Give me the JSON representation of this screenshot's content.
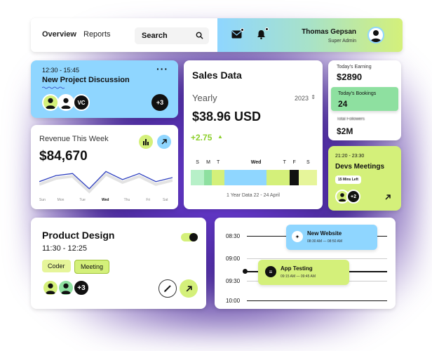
{
  "topbar": {
    "nav": [
      "Overview",
      "Reports"
    ],
    "search_placeholder": "Search",
    "user_name": "Thomas Gepsan",
    "user_role": "Super Admin"
  },
  "meeting_card": {
    "time": "12:30 - 15:45",
    "title": "New Project Discussion",
    "avatar_initials": "VC",
    "extra_count": "+3"
  },
  "revenue": {
    "title": "Revenue This Week",
    "amount": "$84,670",
    "days": [
      "Sun",
      "Mon",
      "Tue",
      "Wed",
      "Thu",
      "Fri",
      "Sat"
    ],
    "active_day": "Wed",
    "series": [
      52,
      58,
      60,
      45,
      62,
      54,
      60,
      52,
      56
    ]
  },
  "sales": {
    "title": "Sales Data",
    "period": "Yearly",
    "year": "2023",
    "amount": "$38.96 USD",
    "change": "+2.75",
    "day_labels": [
      "S",
      "M",
      "T",
      "",
      "Wed",
      "",
      "T",
      "F",
      "S"
    ],
    "footer": "1 Year Data 22 - 24 April",
    "bar_colors": [
      "#b7f0c8",
      "#8ee0a0",
      "#d4f07a",
      "#8fd6ff",
      "#8fd6ff",
      "#d4f07a",
      "#d4f07a",
      "#111111",
      "#e6f59a"
    ]
  },
  "earnings": {
    "today_label": "Today's Earning",
    "today_amount": "$2890",
    "bookings_label": "Today's Bookings",
    "bookings_count": "24",
    "bottom_amount": "$2M",
    "blurred_text": "Total Followers"
  },
  "devs": {
    "time": "21:20 - 23:30",
    "title": "Devs Meetings",
    "badge": "15 Mins Left",
    "extra_count": "+2"
  },
  "product": {
    "title": "Product Design",
    "time": "11:30 - 12:25",
    "tags": [
      "Coder",
      "Meeting"
    ],
    "extra_count": "+3"
  },
  "schedule": {
    "times": [
      "08:30",
      "09:00",
      "09:30",
      "10:00"
    ],
    "events": [
      {
        "title": "New Website",
        "time": "08:30 AM — 08:50 AM"
      },
      {
        "title": "App Testing",
        "time": "09:15 AM — 09:45 AM"
      }
    ]
  },
  "colors": {
    "blue": "#8fd6ff",
    "lime": "#d4f07a",
    "green": "#8ee0a0",
    "line": "#2d3fbf"
  }
}
